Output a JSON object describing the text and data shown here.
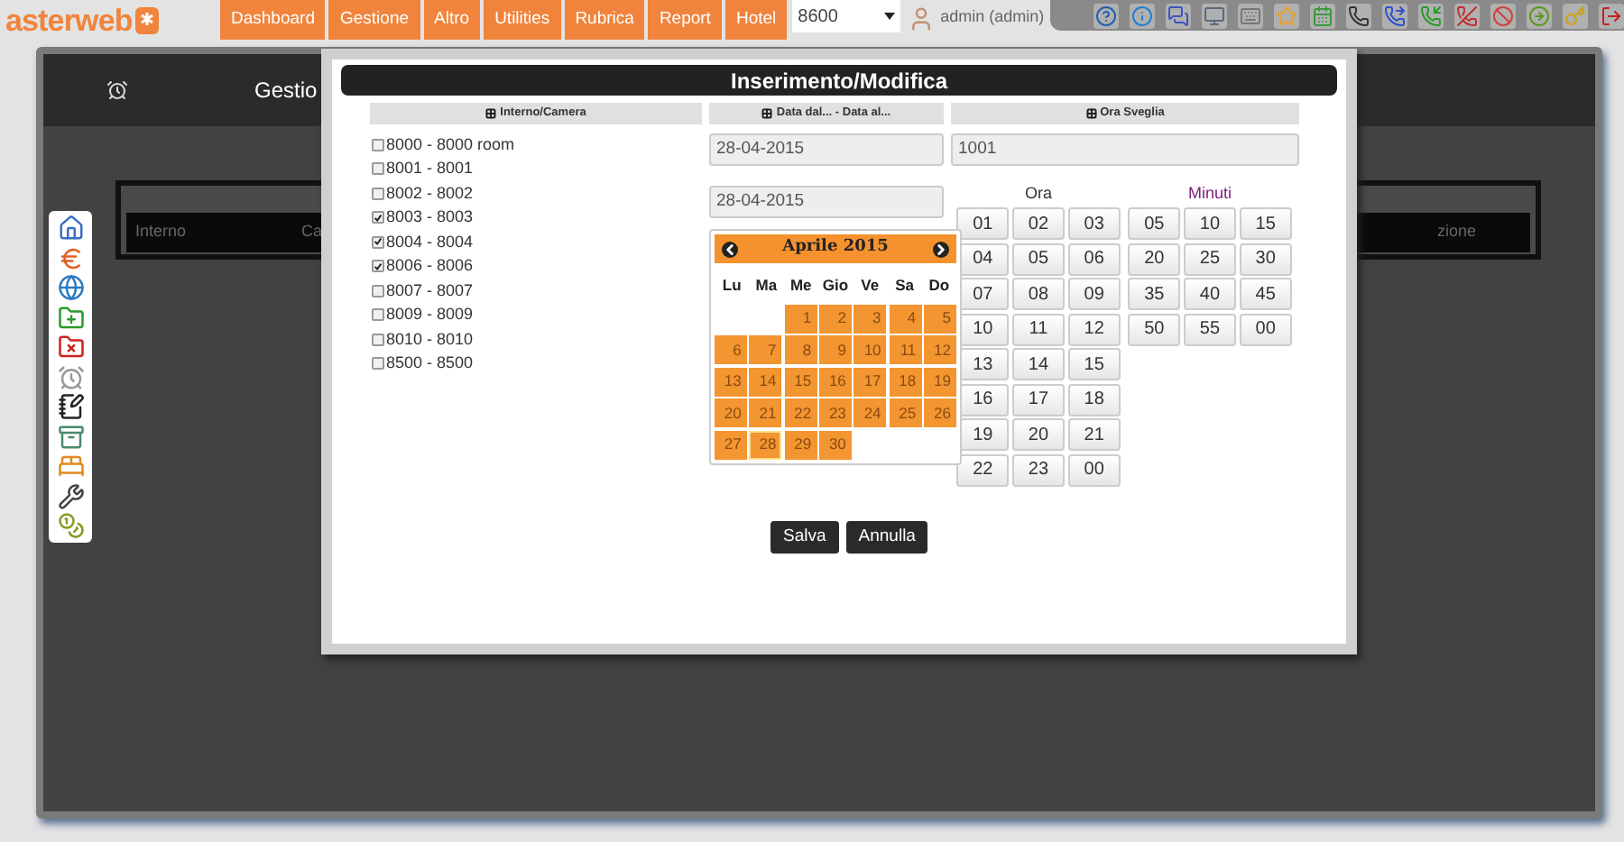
{
  "topbar": {
    "logo": "asterweb",
    "menu": [
      "Dashboard",
      "Gestione",
      "Altro",
      "Utilities",
      "Rubrica",
      "Report",
      "Hotel"
    ],
    "select_value": "8600",
    "user": "admin (admin)"
  },
  "background": {
    "title": "Gestio",
    "columns": [
      "Interno",
      "Ca",
      "zione"
    ]
  },
  "dialog": {
    "title": "Inserimento/Modifica",
    "columns": [
      "Interno/Camera",
      "Data dal... - Data al...",
      "Ora Sveglia"
    ],
    "rooms": [
      {
        "label": "8000 - 8000 room",
        "checked": false
      },
      {
        "label": "8001 - 8001",
        "checked": false
      },
      {
        "label": "8002 - 8002",
        "checked": false
      },
      {
        "label": "8003 - 8003",
        "checked": true
      },
      {
        "label": "8004 - 8004",
        "checked": true
      },
      {
        "label": "8006 - 8006",
        "checked": true
      },
      {
        "label": "8007 - 8007",
        "checked": false
      },
      {
        "label": "8009 - 8009",
        "checked": false
      },
      {
        "label": "8010 - 8010",
        "checked": false
      },
      {
        "label": "8500 - 8500",
        "checked": false
      }
    ],
    "date_from": "28-04-2015",
    "date_to": "28-04-2015",
    "time_value": "1001",
    "calendar": {
      "month": "Aprile 2015",
      "weekdays": [
        "Lu",
        "Ma",
        "Me",
        "Gio",
        "Ve",
        "Sa",
        "Do"
      ],
      "weeks": [
        [
          {
            "kind": "blank"
          },
          {
            "kind": "blank"
          },
          {
            "kind": "day",
            "label": "1",
            "selected": false
          },
          {
            "kind": "day",
            "label": "2",
            "selected": false
          },
          {
            "kind": "day",
            "label": "3",
            "selected": false
          },
          {
            "kind": "day",
            "label": "4",
            "selected": false
          },
          {
            "kind": "day",
            "label": "5",
            "selected": false
          }
        ],
        [
          {
            "kind": "day",
            "label": "6",
            "selected": false
          },
          {
            "kind": "day",
            "label": "7",
            "selected": false
          },
          {
            "kind": "day",
            "label": "8",
            "selected": false
          },
          {
            "kind": "day",
            "label": "9",
            "selected": false
          },
          {
            "kind": "day",
            "label": "10",
            "selected": false
          },
          {
            "kind": "day",
            "label": "11",
            "selected": false
          },
          {
            "kind": "day",
            "label": "12",
            "selected": false
          }
        ],
        [
          {
            "kind": "day",
            "label": "13",
            "selected": false
          },
          {
            "kind": "day",
            "label": "14",
            "selected": false
          },
          {
            "kind": "day",
            "label": "15",
            "selected": false
          },
          {
            "kind": "day",
            "label": "16",
            "selected": false
          },
          {
            "kind": "day",
            "label": "17",
            "selected": false
          },
          {
            "kind": "day",
            "label": "18",
            "selected": false
          },
          {
            "kind": "day",
            "label": "19",
            "selected": false
          }
        ],
        [
          {
            "kind": "day",
            "label": "20",
            "selected": false
          },
          {
            "kind": "day",
            "label": "21",
            "selected": false
          },
          {
            "kind": "day",
            "label": "22",
            "selected": false
          },
          {
            "kind": "day",
            "label": "23",
            "selected": false
          },
          {
            "kind": "day",
            "label": "24",
            "selected": false
          },
          {
            "kind": "day",
            "label": "25",
            "selected": false
          },
          {
            "kind": "day",
            "label": "26",
            "selected": false
          }
        ],
        [
          {
            "kind": "day",
            "label": "27",
            "selected": false
          },
          {
            "kind": "day",
            "label": "28",
            "selected": true
          },
          {
            "kind": "day",
            "label": "29",
            "selected": false
          },
          {
            "kind": "day",
            "label": "30",
            "selected": false
          }
        ]
      ]
    },
    "hours_label": "Ora",
    "hours": [
      "01",
      "02",
      "03",
      "04",
      "05",
      "06",
      "07",
      "08",
      "09",
      "10",
      "11",
      "12",
      "13",
      "14",
      "15",
      "16",
      "17",
      "18",
      "19",
      "20",
      "21",
      "22",
      "23",
      "00"
    ],
    "minutes_label": "Minuti",
    "minutes": [
      "05",
      "10",
      "15",
      "20",
      "25",
      "30",
      "35",
      "40",
      "45",
      "50",
      "55",
      "00"
    ],
    "buttons": [
      "Salva",
      "Annulla"
    ]
  }
}
